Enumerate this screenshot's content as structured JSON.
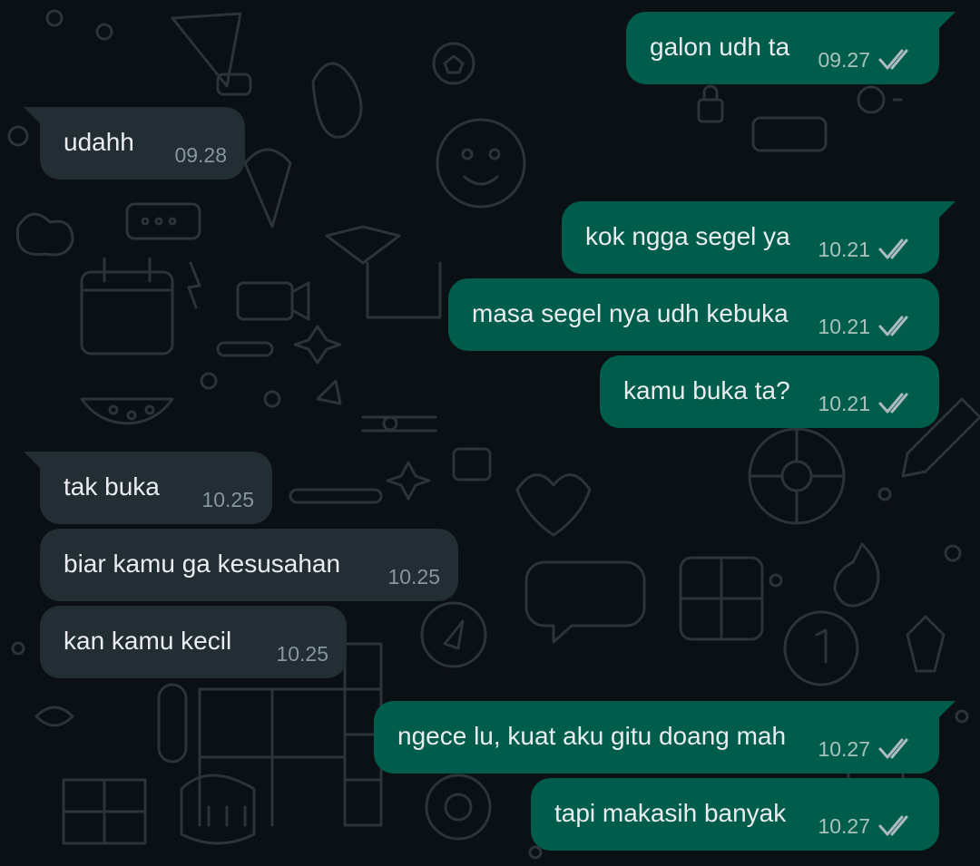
{
  "colors": {
    "background": "#0b1014",
    "incoming_bubble": "#222d34",
    "outgoing_bubble": "#005c4b",
    "message_text": "#e9edef",
    "time_text": "#8696a0",
    "read_ticks": "#aebac1"
  },
  "messages": [
    {
      "direction": "out",
      "text": "galon udh ta",
      "time": "09.27",
      "status_icon": "double-check-icon"
    },
    {
      "direction": "in",
      "text": "udahh",
      "time": "09.28"
    },
    {
      "direction": "out",
      "text": "kok ngga segel ya",
      "time": "10.21",
      "status_icon": "double-check-icon"
    },
    {
      "direction": "out",
      "text": "masa segel nya udh kebuka",
      "time": "10.21",
      "status_icon": "double-check-icon"
    },
    {
      "direction": "out",
      "text": "kamu buka ta?",
      "time": "10.21",
      "status_icon": "double-check-icon"
    },
    {
      "direction": "in",
      "text": "tak buka",
      "time": "10.25"
    },
    {
      "direction": "in",
      "text": "biar kamu ga kesusahan",
      "time": "10.25"
    },
    {
      "direction": "in",
      "text": "kan kamu kecil",
      "time": "10.25"
    },
    {
      "direction": "out",
      "text": "ngece lu, kuat aku gitu doang mah",
      "time": "10.27",
      "status_icon": "double-check-icon"
    },
    {
      "direction": "out",
      "text": "tapi makasih banyak",
      "time": "10.27",
      "status_icon": "double-check-icon"
    }
  ]
}
